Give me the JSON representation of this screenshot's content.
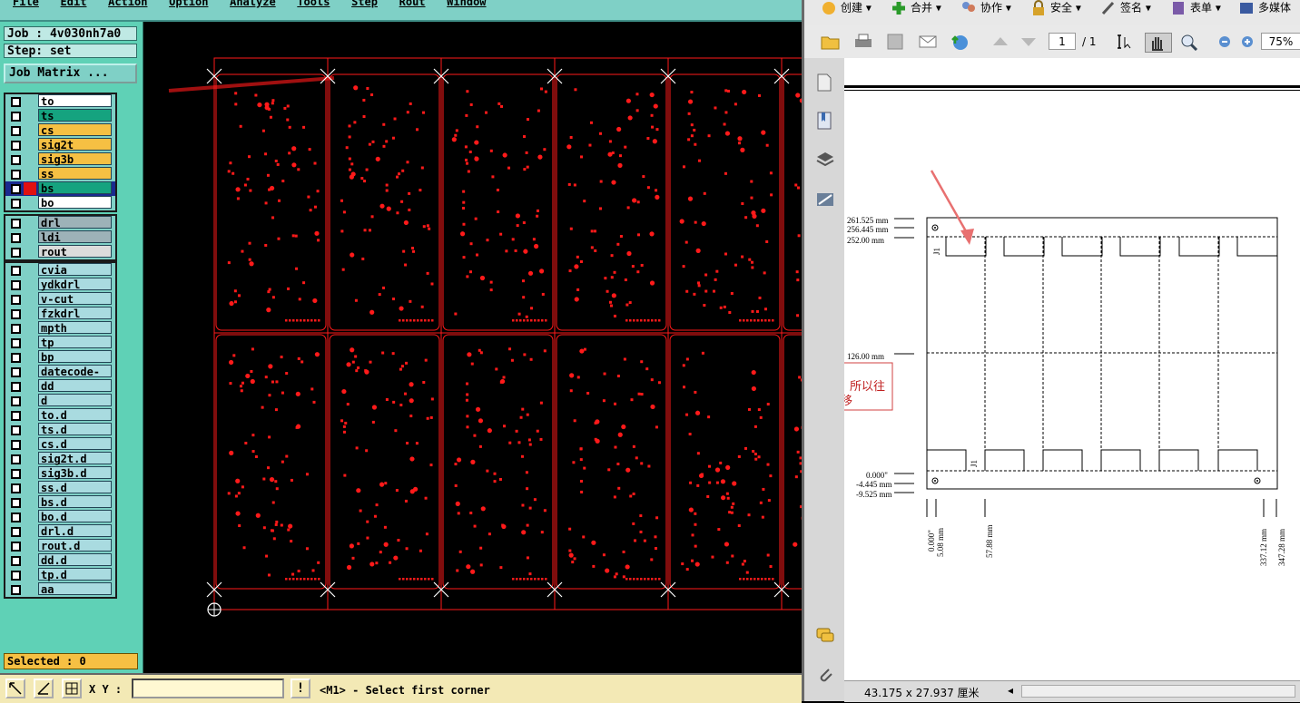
{
  "cam": {
    "menu": [
      "File",
      "Edit",
      "Action",
      "Option",
      "Analyze",
      "Tools",
      "Step",
      "Rout",
      "Window"
    ],
    "job": "Job : 4v030nh7a0",
    "step": "Step: set",
    "job_matrix_label": "Job Matrix ...",
    "layer_groups": [
      [
        {
          "name": "to",
          "color": "#ffffff"
        },
        {
          "name": "ts",
          "color": "#15a37f"
        },
        {
          "name": "cs",
          "color": "#f6c043"
        },
        {
          "name": "sig2t",
          "color": "#f6c043"
        },
        {
          "name": "sig3b",
          "color": "#f6c043"
        },
        {
          "name": "ss",
          "color": "#f6c043"
        },
        {
          "name": "bs",
          "color": "#15a37f",
          "active": true
        },
        {
          "name": "bo",
          "color": "#ffffff"
        }
      ],
      [
        {
          "name": "drl",
          "color": "#9db2b8"
        },
        {
          "name": "ldi",
          "color": "#9db2b8"
        },
        {
          "name": "rout",
          "color": "#dcdcdc"
        }
      ],
      [
        {
          "name": "cvia",
          "color": "#a9dbe0"
        },
        {
          "name": "ydkdrl",
          "color": "#a9dbe0"
        },
        {
          "name": "v-cut",
          "color": "#a9dbe0"
        },
        {
          "name": "fzkdrl",
          "color": "#a9dbe0"
        },
        {
          "name": "mpth",
          "color": "#a9dbe0"
        },
        {
          "name": "tp",
          "color": "#a9dbe0"
        },
        {
          "name": "bp",
          "color": "#a9dbe0"
        },
        {
          "name": "datecode-ss",
          "color": "#a9dbe0"
        },
        {
          "name": "dd",
          "color": "#a9dbe0"
        },
        {
          "name": "d",
          "color": "#a9dbe0"
        },
        {
          "name": "to.d",
          "color": "#a9dbe0"
        },
        {
          "name": "ts.d",
          "color": "#a9dbe0"
        },
        {
          "name": "cs.d",
          "color": "#a9dbe0"
        },
        {
          "name": "sig2t.d",
          "color": "#a9dbe0"
        },
        {
          "name": "sig3b.d",
          "color": "#a9dbe0"
        },
        {
          "name": "ss.d",
          "color": "#a9dbe0"
        },
        {
          "name": "bs.d",
          "color": "#a9dbe0"
        },
        {
          "name": "bo.d",
          "color": "#a9dbe0"
        },
        {
          "name": "drl.d",
          "color": "#a9dbe0"
        },
        {
          "name": "rout.d",
          "color": "#a9dbe0"
        },
        {
          "name": "dd.d",
          "color": "#a9dbe0"
        },
        {
          "name": "tp.d",
          "color": "#a9dbe0"
        },
        {
          "name": "aa",
          "color": "#a9dbe0"
        }
      ]
    ],
    "selected": "Selected : 0",
    "xy_label": "X Y :",
    "xy_value": "",
    "status_message": "<M1> - Select first corner",
    "warning_symbol": "!",
    "pcb_color": "#ff1a1a"
  },
  "pdf": {
    "toolbar": [
      {
        "label": "创建",
        "icon": "create-icon"
      },
      {
        "label": "合并",
        "icon": "combine-icon"
      },
      {
        "label": "协作",
        "icon": "collaborate-icon"
      },
      {
        "label": "安全",
        "icon": "lock-icon"
      },
      {
        "label": "签名",
        "icon": "pen-icon"
      },
      {
        "label": "表单",
        "icon": "form-icon"
      },
      {
        "label": "多媒体",
        "icon": "multimedia-icon"
      }
    ],
    "page_current": "1",
    "page_total": "/ 1",
    "zoom": "75%",
    "page_size": "43.175 x 27.937 厘米",
    "annotation_text_1": "所以往",
    "annotation_text_2": "移",
    "dims": {
      "y1": "261.525 mm",
      "y2": "256.445 mm",
      "y3": "252.00 mm",
      "y4": "126.00 mm",
      "y5": "0.000\"",
      "y6": "-4.445 mm",
      "y7": "-9.525 mm",
      "x1": "0.000\"",
      "x2": "5.08 mm",
      "x3": "57.88 mm",
      "x4": "337.12 mm",
      "x5": "347.28 mm",
      "j1": "J1"
    }
  }
}
